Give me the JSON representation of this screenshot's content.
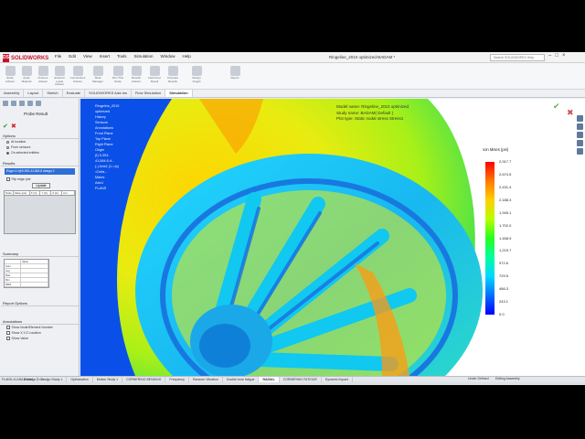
{
  "app": {
    "logo_text": "SOLIDWORKS",
    "menus": [
      "File",
      "Edit",
      "View",
      "Insert",
      "Tools",
      "Simulation",
      "Window",
      "Help"
    ],
    "document_title": "Ringeline_2010 optimized-BADAM *",
    "search_placeholder": "Search SOLIDWORKS Help"
  },
  "command_bar": {
    "items": [
      "Study Advisor",
      "Apply Material",
      "Fixtures Advisor",
      "External Loads Advisor",
      "Connections Advisor",
      "Shell Manager",
      "Run This Study",
      "Results Advisor",
      "Deformed Result",
      "Compare Results",
      "Design Insight",
      "Report"
    ]
  },
  "tabs": [
    "Assembly",
    "Layout",
    "Sketch",
    "Evaluate",
    "SOLIDWORKS Add-Ins",
    "Flow Simulation",
    "Simulation"
  ],
  "active_tab": "Simulation",
  "property_manager": {
    "title": "Probe Result",
    "options_header": "Options",
    "options": [
      "At location",
      "From sensors",
      "On selected entities"
    ],
    "selected_option": "On selected entities",
    "results_header": "Results",
    "result_selection": "Edge<1>@5-353-41J4M-8 design 2",
    "flip_edge_label": "Flip edge plot",
    "update_label": "Update",
    "results_columns": [
      "Node",
      "Value (psi)",
      "X (in)",
      "Y (in)",
      "Z (in)",
      "Cur"
    ],
    "summary_header": "Summary",
    "summary_rows": [
      {
        "label": "",
        "value": "Value"
      },
      {
        "label": "Sum",
        "value": ""
      },
      {
        "label": "Avg",
        "value": ""
      },
      {
        "label": "Max",
        "value": ""
      },
      {
        "label": "Min",
        "value": ""
      },
      {
        "label": "RMS",
        "value": ""
      }
    ],
    "report_header": "Report Options",
    "annotations_header": "Annotations",
    "annotations": [
      "Show Node/Element Number",
      "Show X,Y,Z Location",
      "Show Value"
    ]
  },
  "tree": [
    "Ringeline_2010 optimized",
    "History",
    "Sensors",
    "Annotations",
    "Front Plane",
    "Top Plane",
    "Right Plane",
    "Origin",
    "(f) 5-353-41J4M-8 d...",
    "(-) Axis1 [1->(s) <Defa...",
    "Mates",
    "Axis1",
    "FLANS"
  ],
  "model_info": {
    "model_name": "Model name: Ringeline_2010 optimized",
    "study_name": "Study name: BADAM( Default )",
    "plot_type": "Plot type: Static nodal stress Stress1"
  },
  "legend": {
    "title": "von Mises (psi)",
    "labels": [
      "2,917.7",
      "2,674.5",
      "2,431.4",
      "2,188.3",
      "1,945.1",
      "1,702.0",
      "1,458.9",
      "1,215.7",
      "972.6",
      "729.5",
      "486.3",
      "243.1",
      "0.0"
    ],
    "colors": [
      "#ff0000",
      "#ff7a00",
      "#ffd000",
      "#b8ff00",
      "#28ff20",
      "#00ffa0",
      "#00d8ff",
      "#0070ff",
      "#0000ff"
    ]
  },
  "study_tabs": [
    "Model",
    "Design Study 1",
    "Optimization",
    "Motion Study 1",
    "CORNERING BENDING",
    "Frequency",
    "Random Vibration",
    "Double bore fatigue",
    "RADIAL",
    "CORNERING FATIGUE",
    "Dynamic Impact"
  ],
  "active_study_tab": "RADIAL",
  "status": {
    "left": "FLANS-41J4M-8 design 2<1>",
    "under_defined": "Under Defined",
    "editing": "Editing Assembly"
  }
}
